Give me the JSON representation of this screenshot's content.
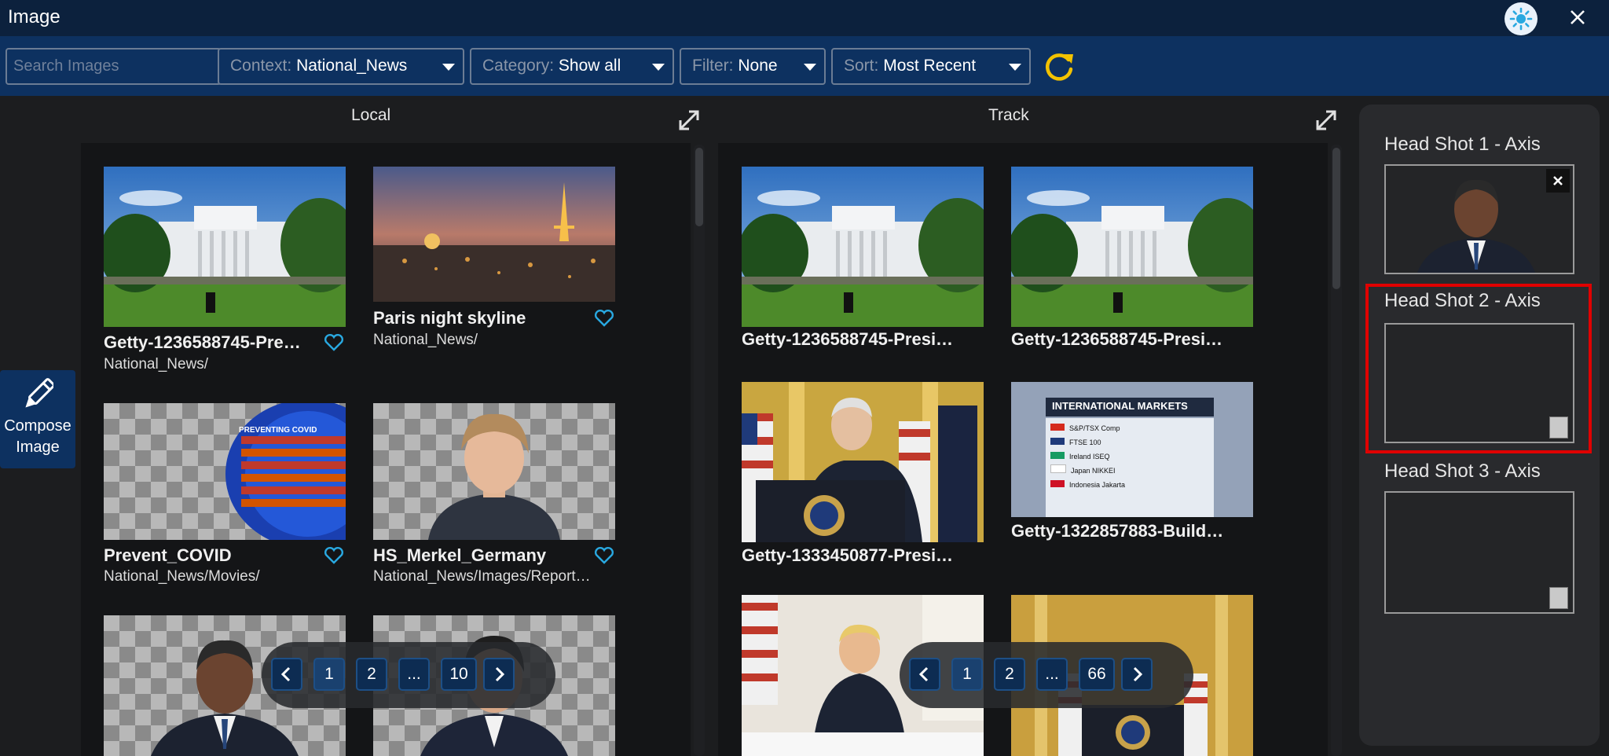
{
  "window": {
    "title": "Image"
  },
  "toolbar": {
    "search_placeholder": "Search Images",
    "context": {
      "label": "Context:",
      "value": "National_News"
    },
    "category": {
      "label": "Category:",
      "value": "Show all"
    },
    "filter": {
      "label": "Filter:",
      "value": "None"
    },
    "sort": {
      "label": "Sort:",
      "value": "Most Recent"
    }
  },
  "compose": {
    "line1": "Compose",
    "line2": "Image"
  },
  "local": {
    "title": "Local",
    "items": [
      {
        "name": "Getty-1236588745-Pre…",
        "path": "National_News/"
      },
      {
        "name": "Paris night skyline",
        "path": "National_News/"
      },
      {
        "name": "Prevent_COVID",
        "path": "National_News/Movies/"
      },
      {
        "name": "HS_Merkel_Germany",
        "path": "National_News/Images/Report…"
      }
    ],
    "pagination": [
      "1",
      "2",
      "...",
      "10"
    ]
  },
  "track": {
    "title": "Track",
    "items": [
      {
        "name": "Getty-1236588745-Presi…"
      },
      {
        "name": "Getty-1236588745-Presi…"
      },
      {
        "name": "Getty-1333450877-Presi…"
      },
      {
        "name": "Getty-1322857883-Build…"
      }
    ],
    "pagination": [
      "1",
      "2",
      "...",
      "66"
    ]
  },
  "slots": {
    "slot1": {
      "title": "Head Shot 1 - Axis"
    },
    "slot2": {
      "title": "Head Shot 2 - Axis"
    },
    "slot3": {
      "title": "Head Shot 3 - Axis"
    }
  },
  "graphics": {
    "markets": {
      "title": "INTERNATIONAL MARKETS",
      "rows": [
        "S&P/TSX Comp",
        "FTSE 100",
        "Ireland ISEQ",
        "Japan NIKKEI",
        "Indonesia Jakarta"
      ]
    },
    "covid": {
      "title": "PREVENTING COVID"
    }
  },
  "colors": {
    "titlebar": "#0c213d",
    "toolbar": "#0d3160",
    "accent": "#29a8e0",
    "refresh": "#f2c200",
    "highlight": "#e00000"
  }
}
